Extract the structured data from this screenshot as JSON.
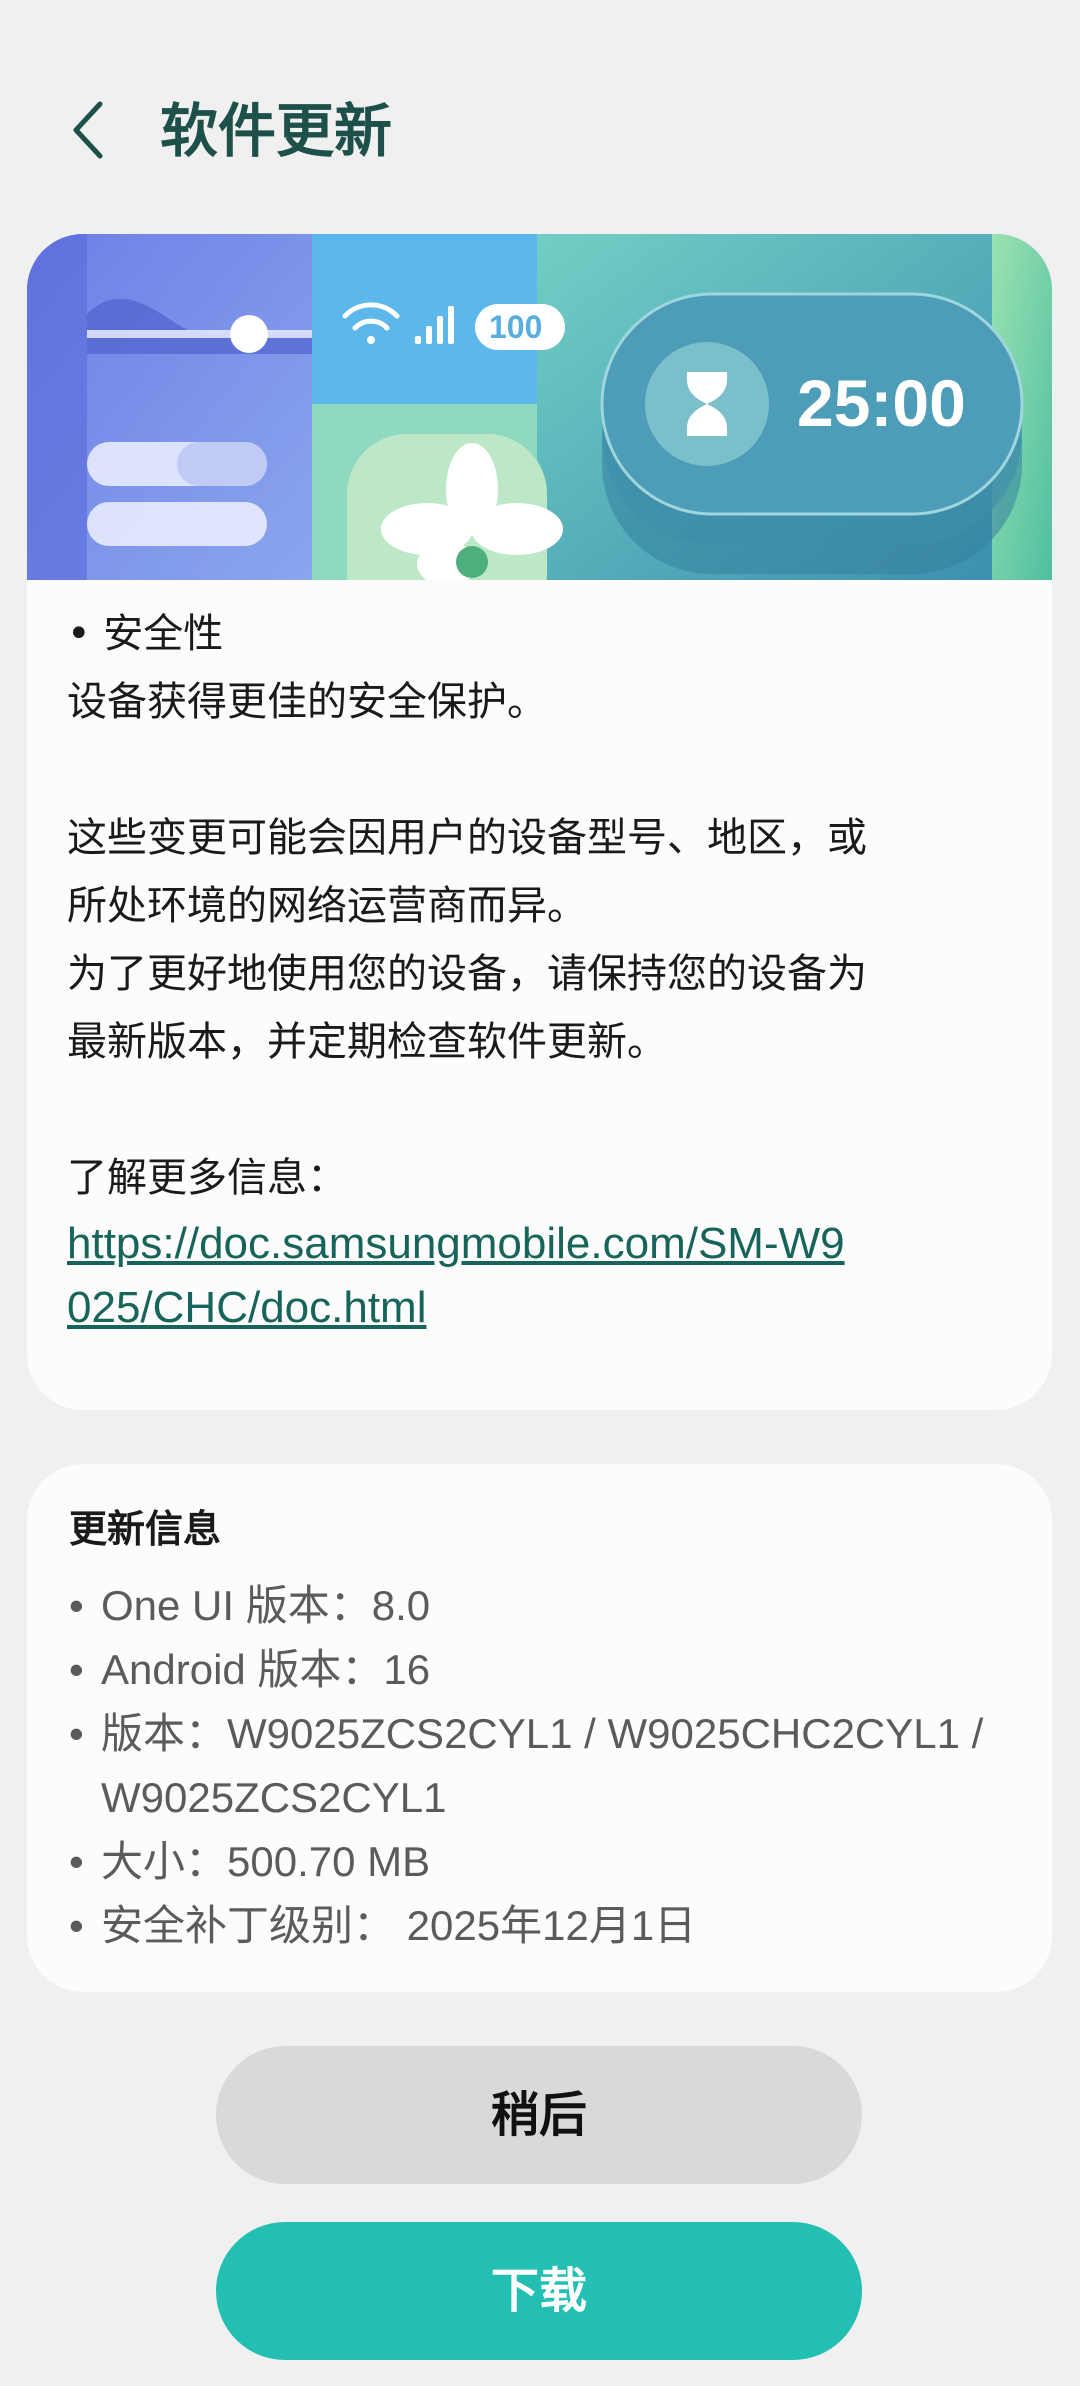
{
  "header": {
    "title": "软件更新",
    "back_icon": "chevron-left-icon"
  },
  "banner": {
    "timer": "25:00",
    "battery": "100",
    "icons": [
      "wifi-icon",
      "signal-icon",
      "hourglass-icon",
      "flower-icon"
    ],
    "colors": {
      "accent": "#23bfb2",
      "title": "#1d5049",
      "link": "#17645a"
    }
  },
  "description": {
    "lines": [
      "• 安全性",
      "设备获得更佳的安全保护。",
      "这些变更可能会因用户的设备型号、地区，或",
      "所处环境的网络运营商而异。",
      "为了更好地使用您的设备，请保持您的设备为",
      "最新版本，并定期检查软件更新。",
      "了解更多信息："
    ],
    "link": "https://doc.samsungmobile.com/SM-W9025/CHC/doc.html"
  },
  "update_info": {
    "title": "更新信息",
    "items": [
      "One UI 版本：8.0",
      "Android 版本：16",
      "版本：W9025ZCS2CYL1 / W9025CHC2CYL1 / W9025ZCS2CYL1",
      "大小：500.70 MB",
      "安全补丁级别： 2025年12月1日"
    ]
  },
  "buttons": {
    "later": "稍后",
    "download": "下载"
  }
}
